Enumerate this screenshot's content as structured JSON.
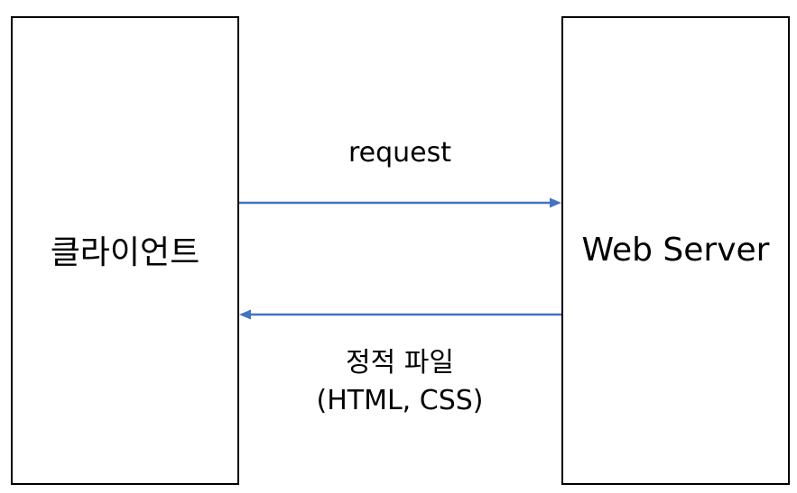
{
  "client": {
    "label": "클라이언트"
  },
  "server": {
    "label": "Web Server"
  },
  "request": {
    "label": "request"
  },
  "response": {
    "line1": "정적 파일",
    "line2": "(HTML, CSS)"
  },
  "colors": {
    "arrow": "#4472C4",
    "border": "#000000"
  }
}
